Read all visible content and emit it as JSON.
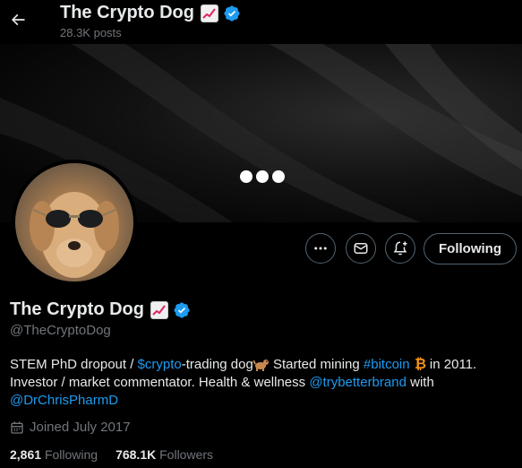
{
  "header": {
    "back_icon": "arrow-left-icon",
    "title": "The Crypto Dog",
    "title_emoji": "chart-increasing-icon",
    "posts_count": "28.3K posts"
  },
  "banner": {
    "loading_indicator": "three-dots"
  },
  "actions": {
    "more_icon": "more-icon",
    "message_icon": "envelope-icon",
    "notify_icon": "bell-plus-icon",
    "follow_label": "Following"
  },
  "profile": {
    "display_name": "The Crypto Dog",
    "handle": "@TheCryptoDog",
    "bio": {
      "part1": "STEM PhD dropout / ",
      "cashtag": "$crypto",
      "part2": "-trading dog",
      "part3": " Started mining ",
      "hashtag": "#bitcoin",
      "part4": " in 2011. Investor / market commentator. Health & wellness ",
      "mention1": "@trybetterbrand",
      "part5": " with ",
      "mention2": "@DrChrisPharmD"
    },
    "joined": "Joined July 2017",
    "following_count": "2,861",
    "following_label": "Following",
    "followers_count": "768.1K",
    "followers_label": "Followers"
  },
  "colors": {
    "accent": "#1d9bf0",
    "muted": "#71767b",
    "bitcoin": "#f7931a"
  }
}
